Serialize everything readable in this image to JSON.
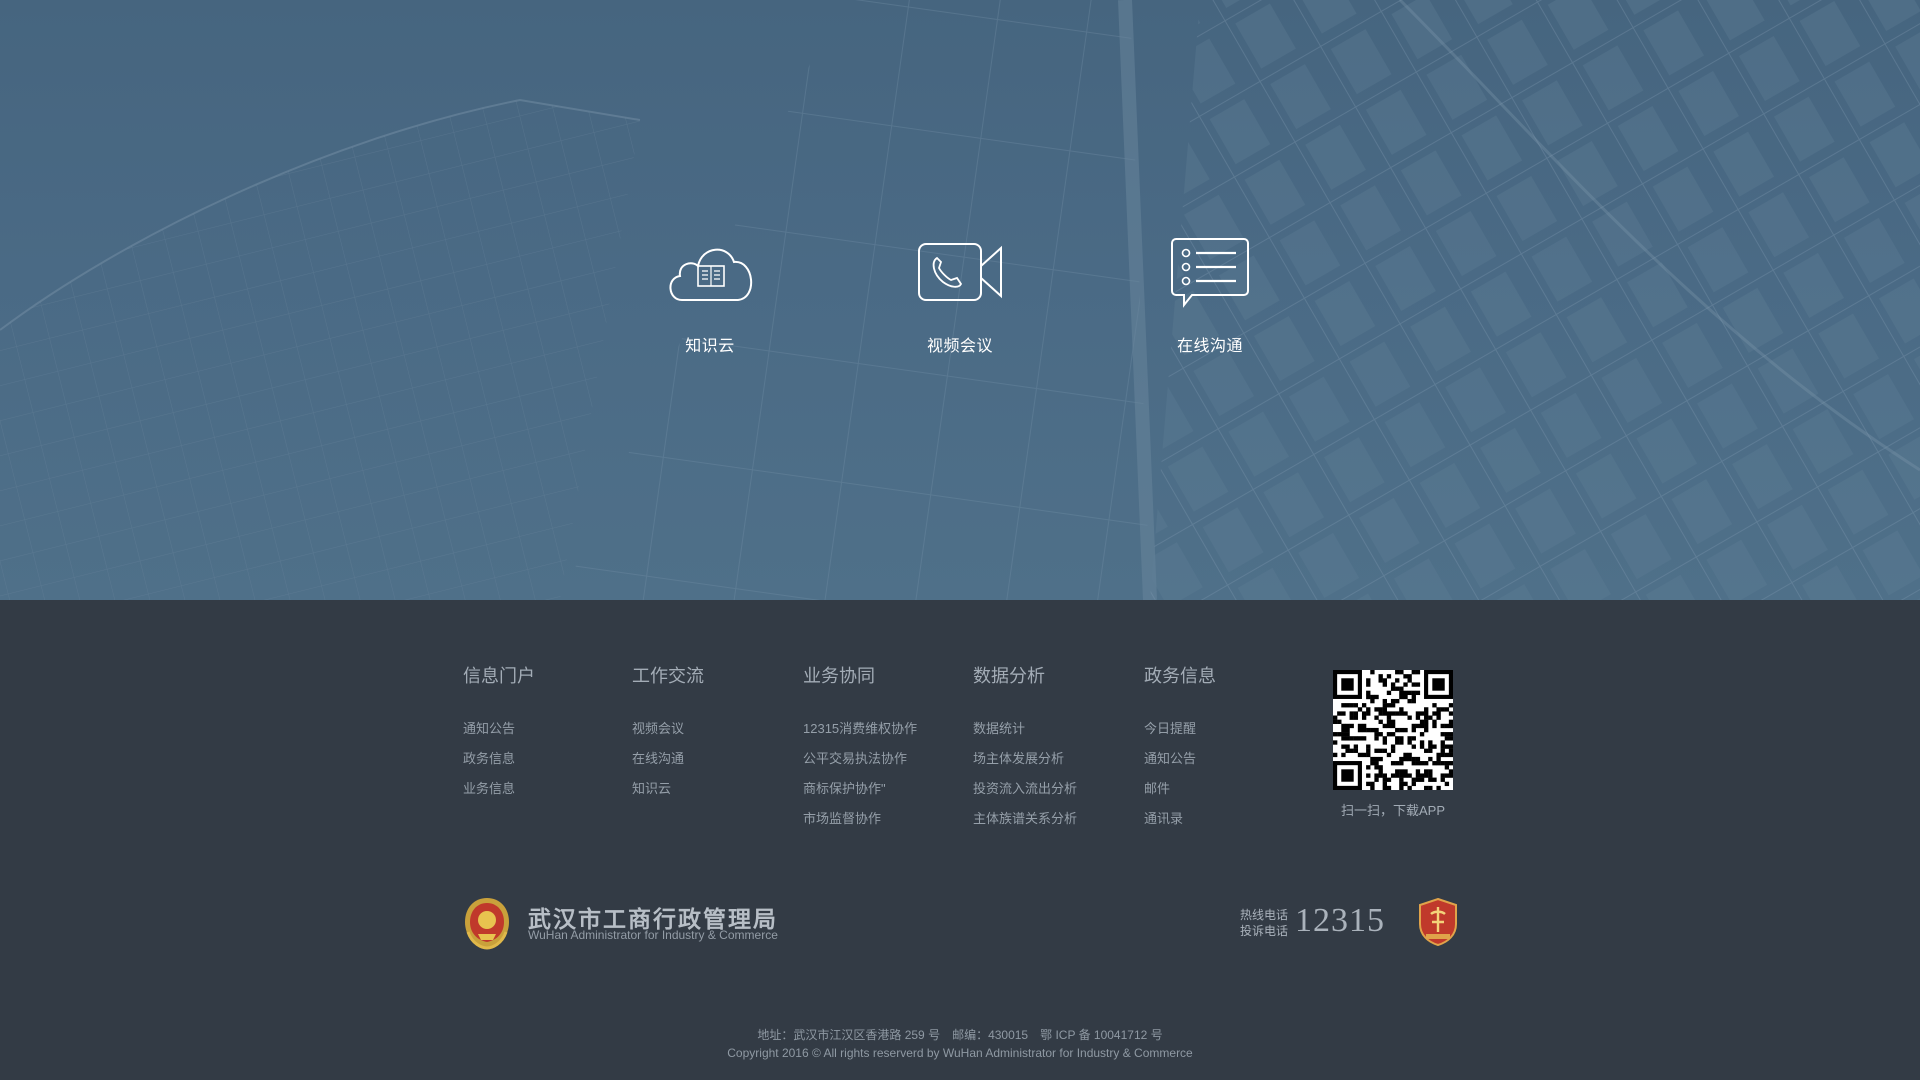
{
  "quick_links": [
    {
      "label": "知识云",
      "icon": "cloud-book-icon"
    },
    {
      "label": "视频会议",
      "icon": "video-call-icon"
    },
    {
      "label": "在线沟通",
      "icon": "chat-list-icon"
    }
  ],
  "footer": {
    "columns": [
      {
        "title": "信息门户",
        "links": [
          "通知公告",
          "政务信息",
          "业务信息"
        ]
      },
      {
        "title": "工作交流",
        "links": [
          "视频会议",
          "在线沟通",
          "知识云"
        ]
      },
      {
        "title": "业务协同",
        "links": [
          "12315消费维权协作",
          "公平交易执法协作",
          "商标保护协作\"",
          "市场监督协作"
        ]
      },
      {
        "title": "数据分析",
        "links": [
          "数据统计",
          "场主体发展分析",
          "投资流入流出分析",
          "主体族谱关系分析"
        ]
      },
      {
        "title": "政务信息",
        "links": [
          "今日提醒",
          "通知公告",
          "邮件",
          "通讯录"
        ]
      }
    ],
    "qr_caption": "扫一扫，下载APP",
    "org_name": "武汉市工商行政管理局",
    "org_name_en": "WuHan Administrator for Industry & Commerce",
    "hotline_label": "热线电话",
    "complaint_label": "投诉电话",
    "hotline_number": "12315",
    "address_line": "地址：武汉市江汉区香港路 259 号　邮编：430015　鄂 ICP 备 10041712 号",
    "copyright": "Copyright 2016 © All rights reserverd by WuHan Administrator for Industry & Commerce"
  },
  "colors": {
    "hero": "#4a6a85",
    "footer": "#333b45",
    "text": "#a3acb6"
  }
}
